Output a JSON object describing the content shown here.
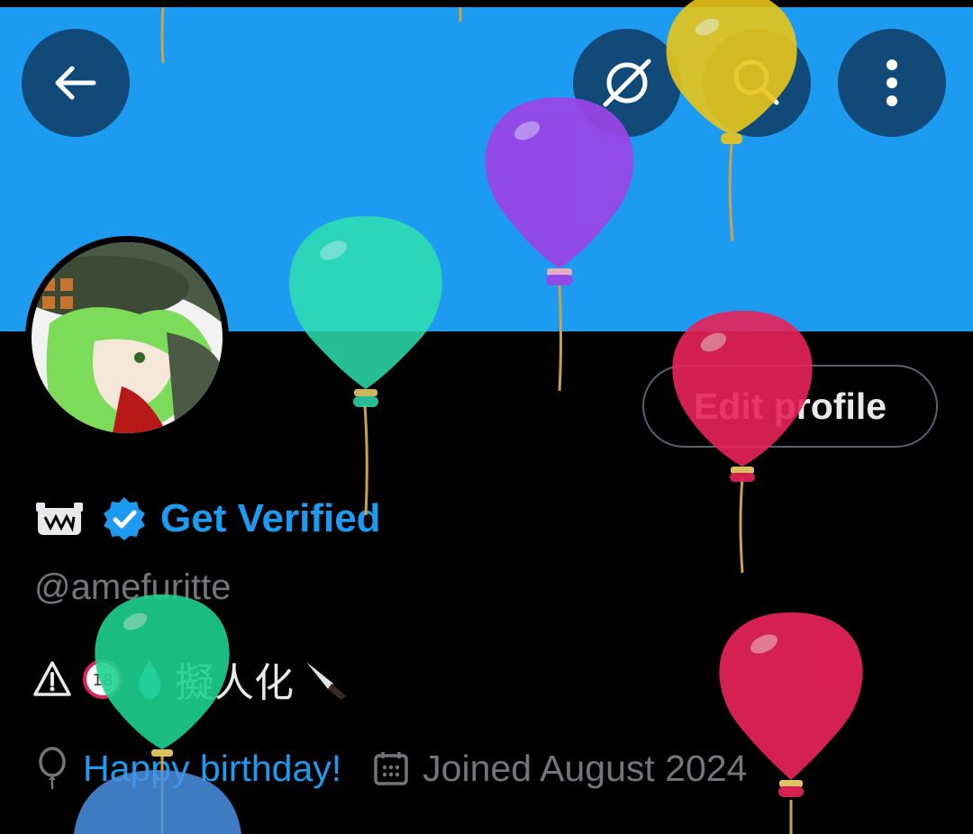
{
  "header": {
    "back_icon": "arrow-left-icon",
    "premium_icon": "circle-slash-icon",
    "search_icon": "search-icon",
    "more_icon": "more-vertical-icon"
  },
  "profile": {
    "edit_label": "Edit profile",
    "get_verified_label": "Get Verified",
    "handle": "@amefuritte",
    "bio_text": "擬人化",
    "birthday_text": "Happy birthday!",
    "joined_text": "Joined August 2024"
  },
  "colors": {
    "banner": "#1d9bf0",
    "accent": "#1d9bf0",
    "muted": "#71767b",
    "text": "#e7e9ea"
  }
}
